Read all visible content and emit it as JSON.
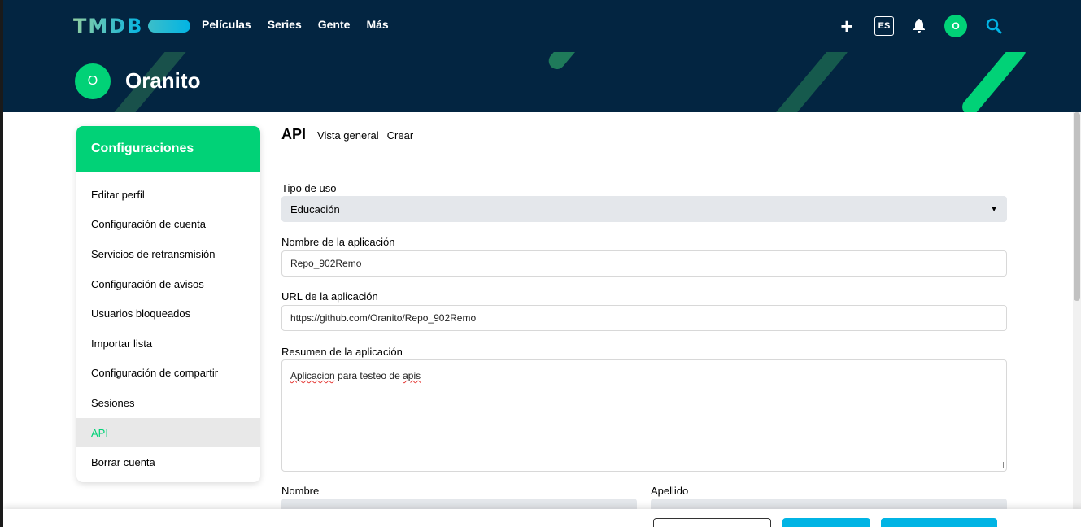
{
  "nav": {
    "logo": "TMDB",
    "links": [
      "Películas",
      "Series",
      "Gente",
      "Más"
    ],
    "lang": "ES",
    "avatar_initial": "O"
  },
  "profile": {
    "initial": "O",
    "name": "Oranito"
  },
  "sidebar": {
    "heading": "Configuraciones",
    "items": [
      "Editar perfil",
      "Configuración de cuenta",
      "Servicios de retransmisión",
      "Configuración de avisos",
      "Usuarios bloqueados",
      "Importar lista",
      "Configuración de compartir",
      "Sesiones",
      "API",
      "Borrar cuenta"
    ],
    "active_index": 8
  },
  "subnav": {
    "title": "API",
    "links": [
      "Vista general",
      "Crear"
    ]
  },
  "form": {
    "usage_label": "Tipo de uso",
    "usage_value": "Educación",
    "app_name_label": "Nombre de la aplicación",
    "app_name_value": "Repo_902Remo",
    "app_url_label": "URL de la aplicación",
    "app_url_value": "https://github.com/Oranito/Repo_902Remo",
    "summary_label": "Resumen de la aplicación",
    "summary_value_word1": "Aplicacion",
    "summary_value_mid": " para testeo de ",
    "summary_value_word2": "apis",
    "first_name_label": "Nombre",
    "last_name_label": "Apellido"
  },
  "colors": {
    "nav_bg": "#032541",
    "accent_green": "#01d277",
    "accent_blue": "#01b4e4"
  }
}
